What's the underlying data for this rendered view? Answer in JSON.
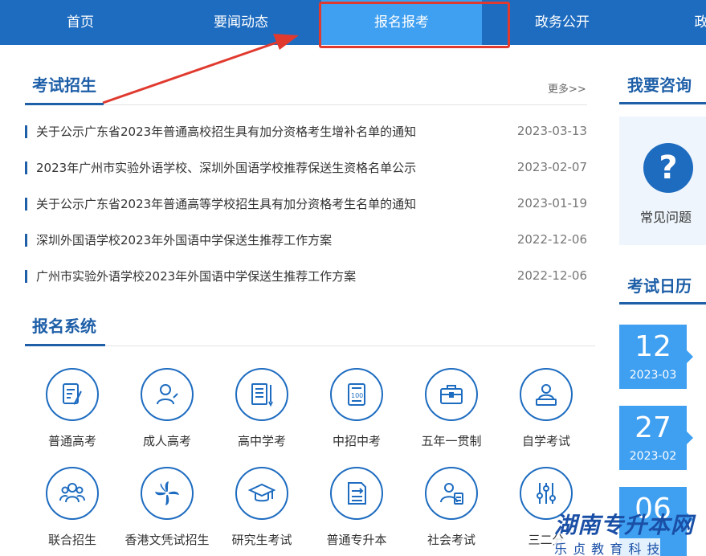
{
  "nav": {
    "items": [
      {
        "label": "首页"
      },
      {
        "label": "要闻动态"
      },
      {
        "label": "报名报考",
        "active": true
      },
      {
        "label": "政务公开"
      },
      {
        "label": "政"
      }
    ],
    "accent": "#1e6cc0",
    "active_color": "#3f9ff0",
    "annotation_color": "#e03a2f"
  },
  "exam": {
    "title": "考试招生",
    "more": "更多>>",
    "news": [
      {
        "title": "关于公示广东省2023年普通高校招生具有加分资格考生增补名单的通知",
        "date": "2023-03-13"
      },
      {
        "title": "2023年广州市实验外语学校、深圳外国语学校推荐保送生资格名单公示",
        "date": "2023-02-07"
      },
      {
        "title": "关于公示广东省2023年普通高等学校招生具有加分资格考生名单的通知",
        "date": "2023-01-19"
      },
      {
        "title": "深圳外国语学校2023年外国语中学保送生推荐工作方案",
        "date": "2022-12-06"
      },
      {
        "title": "广州市实验外语学校2023年外国语中学保送生推荐工作方案",
        "date": "2022-12-06"
      }
    ]
  },
  "system": {
    "title": "报名系统",
    "items": [
      {
        "label": "普通高考",
        "icon": "form-pen-icon"
      },
      {
        "label": "成人高考",
        "icon": "adult-person-icon"
      },
      {
        "label": "高中学考",
        "icon": "document-pencil-icon"
      },
      {
        "label": "中招中考",
        "icon": "score-sheet-icon"
      },
      {
        "label": "五年一贯制",
        "icon": "briefcase-icon"
      },
      {
        "label": "自学考试",
        "icon": "self-study-icon"
      },
      {
        "label": "联合招生",
        "icon": "group-people-icon"
      },
      {
        "label": "香港文凭试招生",
        "icon": "bauhinia-flower-icon"
      },
      {
        "label": "研究生考试",
        "icon": "graduation-cap-icon"
      },
      {
        "label": "普通专升本",
        "icon": "upgrade-document-icon"
      },
      {
        "label": "社会考试",
        "icon": "exam-person-icon"
      },
      {
        "label": "三二分",
        "icon": "sliders-icon"
      }
    ]
  },
  "consult": {
    "title": "我要咨询",
    "faq_label": "常见问题",
    "faq_symbol": "?"
  },
  "calendar": {
    "title": "考试日历",
    "entries": [
      {
        "day": "12",
        "ym": "2023-03"
      },
      {
        "day": "27",
        "ym": "2023-02"
      },
      {
        "day": "06",
        "ym": ""
      }
    ]
  },
  "watermark": {
    "main": "湖南专升本网",
    "sub": "乐 贞 教 育 科 技"
  }
}
